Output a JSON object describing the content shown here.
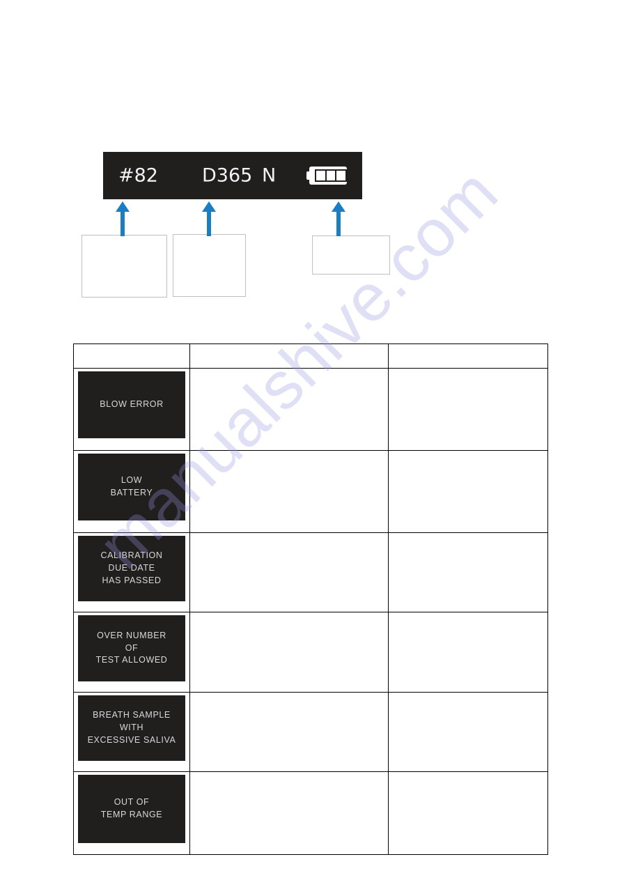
{
  "display_bar": {
    "test_count": "#82",
    "days_remaining": "D365",
    "mode_indicator": "N",
    "battery_icon": "battery-full-icon",
    "battery_segments": 3,
    "background_color": "#211e1e",
    "text_color": "#f2f2f2"
  },
  "callouts": {
    "accent_color": "#1b7ec4",
    "items": [
      {
        "id": "callout-test-count",
        "text": "",
        "arrow_icon": "arrow-up-icon"
      },
      {
        "id": "callout-days-remaining",
        "text": "",
        "arrow_icon": "arrow-up-icon"
      },
      {
        "id": "callout-battery",
        "text": "",
        "arrow_icon": "arrow-up-icon"
      }
    ]
  },
  "messages_table": {
    "headers": [
      "",
      "",
      ""
    ],
    "rows": [
      {
        "screen_text": "BLOW ERROR",
        "cause": "",
        "solution": ""
      },
      {
        "screen_text": "LOW\nBATTERY",
        "cause": "",
        "solution": ""
      },
      {
        "screen_text": "CALIBRATION\nDUE DATE\nHAS PASSED",
        "cause": "",
        "solution": ""
      },
      {
        "screen_text": "OVER NUMBER\nOF\nTEST ALLOWED",
        "cause": "",
        "solution": ""
      },
      {
        "screen_text": "BREATH SAMPLE\nWITH\nEXCESSIVE SALIVA",
        "cause": "",
        "solution": ""
      },
      {
        "screen_text": "OUT OF\nTEMP RANGE",
        "cause": "",
        "solution": ""
      }
    ]
  },
  "watermark": {
    "text": "manualshive.com",
    "color": "#9696e1"
  }
}
